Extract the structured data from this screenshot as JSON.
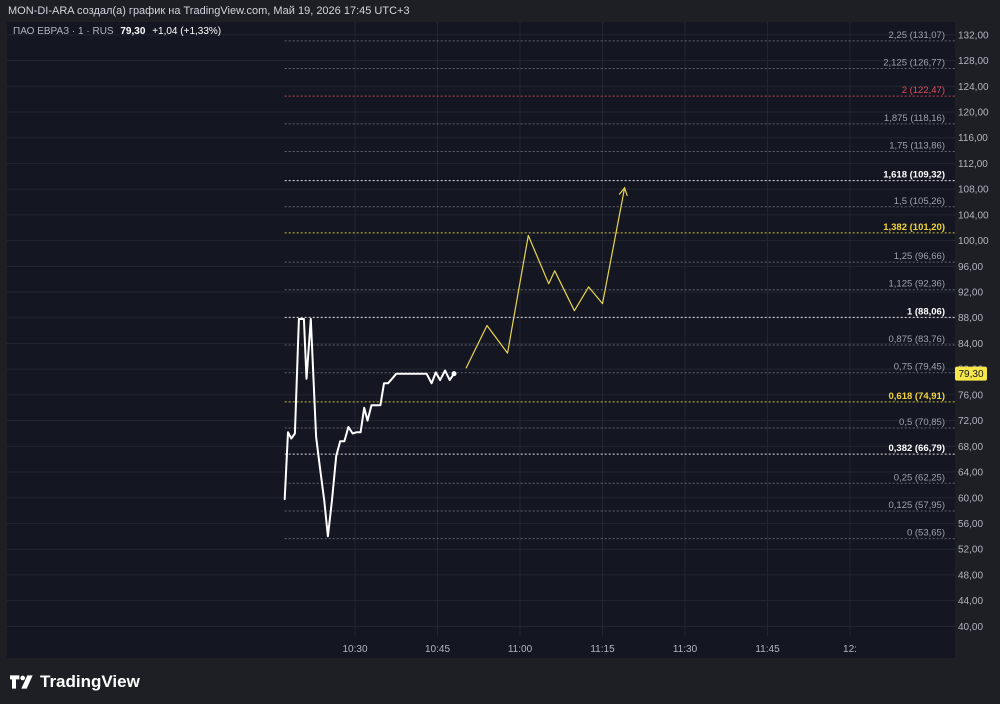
{
  "header": {
    "title": "MON-DI-ARA создал(а) график на TradingView.com, Май 19, 2026 17:45 UTC+3"
  },
  "legend": {
    "symbol": "ПАО ЕВРАЗ · 1 · RUS",
    "last": "79,30",
    "change": "+1,04 (+1,33%)"
  },
  "footer": {
    "brand": "TradingView"
  },
  "colors": {
    "price_line": "#ffffff",
    "projection": "#e8d44d",
    "fib_default": "#a0a3ad",
    "fib_highlight": "#f0d33a",
    "fib_red": "#e04a56",
    "price_label_bg": "#f5e64a"
  },
  "chart_data": {
    "type": "line",
    "ylim": [
      38.5,
      134
    ],
    "yticks": [
      "132,00",
      "128,00",
      "124,00",
      "120,00",
      "116,00",
      "112,00",
      "108,00",
      "104,00",
      "100,00",
      "96,00",
      "92,00",
      "88,00",
      "84,00",
      "80,00",
      "76,00",
      "72,00",
      "68,00",
      "64,00",
      "60,00",
      "56,00",
      "52,00",
      "48,00",
      "44,00",
      "40,00"
    ],
    "xticks": [
      {
        "label": "10:30",
        "t": 10.5
      },
      {
        "label": "10:45",
        "t": 10.75
      },
      {
        "label": "11:00",
        "t": 11.0
      },
      {
        "label": "11:15",
        "t": 11.25
      },
      {
        "label": "11:30",
        "t": 11.5
      },
      {
        "label": "11:45",
        "t": 11.75
      },
      {
        "label": "12:",
        "t": 12.0
      }
    ],
    "current_price": {
      "value": 79.3,
      "label": "79,30"
    },
    "series": [
      {
        "points": [
          [
            10.287,
            59.8
          ],
          [
            10.297,
            70.2
          ],
          [
            10.307,
            69.2
          ],
          [
            10.318,
            70.0
          ],
          [
            10.33,
            87.8
          ],
          [
            10.345,
            87.8
          ],
          [
            10.353,
            78.5
          ],
          [
            10.366,
            87.8
          ],
          [
            10.382,
            69.5
          ],
          [
            10.393,
            65.0
          ],
          [
            10.407,
            59.5
          ],
          [
            10.418,
            54.0
          ],
          [
            10.43,
            59.5
          ],
          [
            10.443,
            66.5
          ],
          [
            10.455,
            68.8
          ],
          [
            10.468,
            68.8
          ],
          [
            10.48,
            71.0
          ],
          [
            10.493,
            70.0
          ],
          [
            10.505,
            70.2
          ],
          [
            10.517,
            70.2
          ],
          [
            10.528,
            74.0
          ],
          [
            10.538,
            72.0
          ],
          [
            10.55,
            74.4
          ],
          [
            10.563,
            74.4
          ],
          [
            10.577,
            74.4
          ],
          [
            10.588,
            77.8
          ],
          [
            10.6,
            77.8
          ],
          [
            10.612,
            78.5
          ],
          [
            10.625,
            79.3
          ],
          [
            10.64,
            79.3
          ],
          [
            10.655,
            79.3
          ],
          [
            10.67,
            79.3
          ],
          [
            10.683,
            79.3
          ],
          [
            10.7,
            79.3
          ],
          [
            10.717,
            79.3
          ],
          [
            10.732,
            77.8
          ],
          [
            10.745,
            79.5
          ],
          [
            10.758,
            78.3
          ],
          [
            10.773,
            79.8
          ],
          [
            10.787,
            78.3
          ],
          [
            10.8,
            79.3
          ]
        ]
      },
      {
        "points": [
          [
            10.837,
            80.2
          ],
          [
            10.9,
            86.8
          ],
          [
            10.962,
            82.5
          ],
          [
            11.025,
            100.8
          ],
          [
            11.087,
            93.3
          ],
          [
            11.105,
            95.3
          ],
          [
            11.165,
            89.1
          ],
          [
            11.208,
            92.8
          ],
          [
            11.25,
            90.2
          ],
          [
            11.317,
            108.2
          ]
        ]
      }
    ],
    "fib_levels": [
      {
        "ratio": "2,25",
        "price": 131.07,
        "label": "2,25 (131,07)",
        "style": "default"
      },
      {
        "ratio": "2,125",
        "price": 126.77,
        "label": "2,125 (126,77)",
        "style": "default"
      },
      {
        "ratio": "2",
        "price": 122.47,
        "label": "2 (122,47)",
        "style": "red"
      },
      {
        "ratio": "1,875",
        "price": 118.16,
        "label": "1,875 (118,16)",
        "style": "default"
      },
      {
        "ratio": "1,75",
        "price": 113.86,
        "label": "1,75 (113,86)",
        "style": "default"
      },
      {
        "ratio": "1,618",
        "price": 109.32,
        "label": "1,618 (109,32)",
        "style": "bold"
      },
      {
        "ratio": "1,5",
        "price": 105.26,
        "label": "1,5 (105,26)",
        "style": "default"
      },
      {
        "ratio": "1,382",
        "price": 101.2,
        "label": "1,382 (101,20)",
        "style": "yellow"
      },
      {
        "ratio": "1,25",
        "price": 96.66,
        "label": "1,25 (96,66)",
        "style": "default"
      },
      {
        "ratio": "1,125",
        "price": 92.36,
        "label": "1,125 (92,36)",
        "style": "default"
      },
      {
        "ratio": "1",
        "price": 88.06,
        "label": "1 (88,06)",
        "style": "bold"
      },
      {
        "ratio": "0,875",
        "price": 83.76,
        "label": "0,875 (83,76)",
        "style": "default"
      },
      {
        "ratio": "0,75",
        "price": 79.45,
        "label": "0,75 (79,45)",
        "style": "default"
      },
      {
        "ratio": "0,618",
        "price": 74.91,
        "label": "0,618 (74,91)",
        "style": "yellow"
      },
      {
        "ratio": "0,5",
        "price": 70.85,
        "label": "0,5 (70,85)",
        "style": "default"
      },
      {
        "ratio": "0,382",
        "price": 66.79,
        "label": "0,382 (66,79)",
        "style": "bold"
      },
      {
        "ratio": "0,25",
        "price": 62.25,
        "label": "0,25 (62,25)",
        "style": "default"
      },
      {
        "ratio": "0,125",
        "price": 57.95,
        "label": "0,125 (57,95)",
        "style": "default"
      },
      {
        "ratio": "0",
        "price": 53.65,
        "label": "0 (53,65)",
        "style": "default"
      }
    ]
  }
}
